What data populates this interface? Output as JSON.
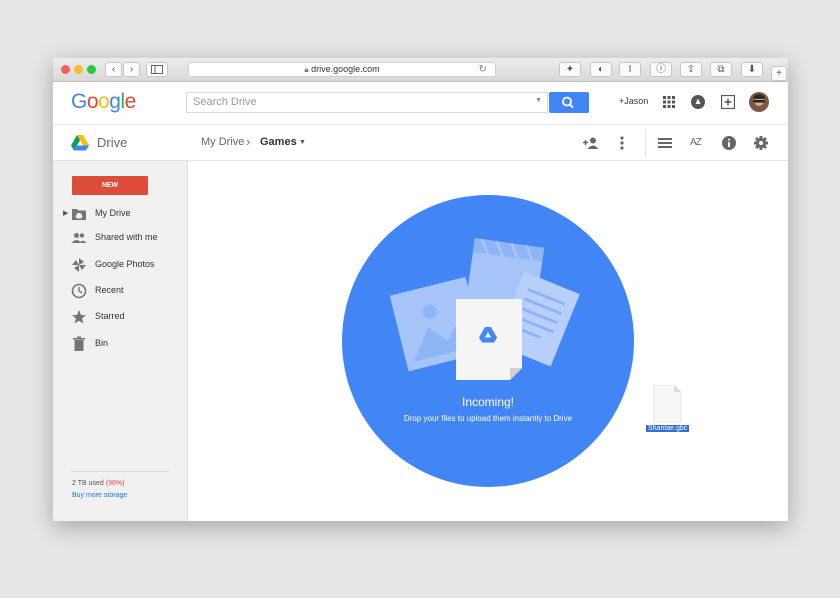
{
  "browser": {
    "url": "drive.google.com",
    "nav_back": "‹",
    "nav_forward": "›"
  },
  "header": {
    "logo_letters": [
      "G",
      "o",
      "o",
      "g",
      "l",
      "e"
    ],
    "logo_colors": [
      "#4285f4",
      "#ea4335",
      "#fbbc05",
      "#4285f4",
      "#34a853",
      "#ea4335"
    ],
    "search_placeholder": "Search Drive",
    "user_link": "+Jason"
  },
  "toolbar": {
    "app_name": "Drive",
    "breadcrumb_root": "My Drive",
    "breadcrumb_current": "Games",
    "sort_label": "AZ"
  },
  "sidebar": {
    "new_label": "NEW",
    "items": [
      {
        "label": "My Drive",
        "icon": "folder-drive-icon"
      },
      {
        "label": "Shared with me",
        "icon": "people-icon"
      },
      {
        "label": "Google Photos",
        "icon": "pinwheel-icon"
      },
      {
        "label": "Recent",
        "icon": "clock-icon"
      },
      {
        "label": "Starred",
        "icon": "star-icon"
      },
      {
        "label": "Bin",
        "icon": "trash-icon"
      }
    ],
    "storage_text": "2 TB used",
    "storage_percent": "(96%)",
    "buy_storage": "Buy more storage"
  },
  "dropzone": {
    "title": "Incoming!",
    "subtitle": "Drop your files to upload them instantly to Drive",
    "dragged_file": "Shantae.gbc"
  },
  "colors": {
    "accent_blue": "#4285f4",
    "new_red": "#dd4b39",
    "storage_red": "#dd4b39",
    "link_blue": "#1a73e8"
  }
}
